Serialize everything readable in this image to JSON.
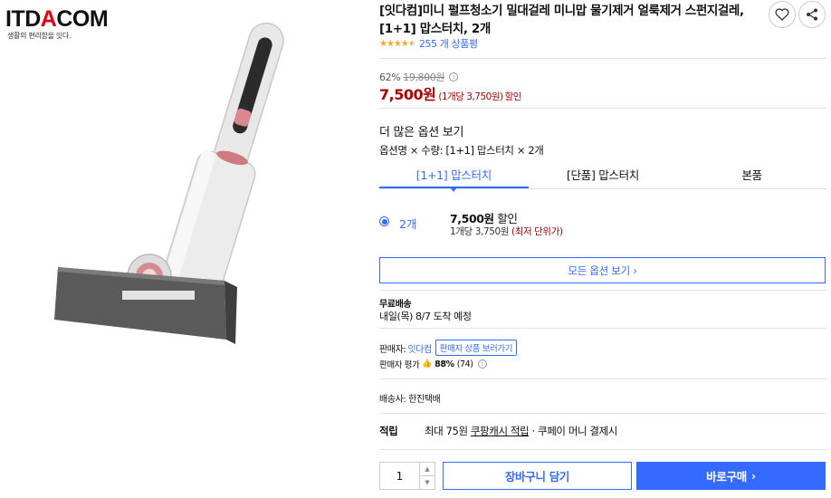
{
  "brand": {
    "logo_prefix": "ITD",
    "logo_a": "A",
    "logo_suffix": "COM",
    "tagline": "생활의 편리함을 잇다."
  },
  "product": {
    "title": "[잇다컴]미니 펄프청소기 밀대걸레 미니맙 물기제거 얼룩제거 스펀지걸레, [1+1] 맙스터치, 2개",
    "rating": 4.5,
    "review_count": "255 개 상품평"
  },
  "pricing": {
    "discount_rate": "62%",
    "original_price": "19,800원",
    "sale_price": "7,500원",
    "unit_price": "(1개당 3,750원)",
    "sale_suffix": "할인"
  },
  "options": {
    "more_title": "더 많은 옵션 보기",
    "selected_text": "옵션명 × 수량: [1+1] 맙스터치 × 2개",
    "tabs": [
      {
        "label": "[1+1] 맙스터치",
        "active": true
      },
      {
        "label": "[단품] 맙스터치",
        "active": false
      },
      {
        "label": "본품",
        "active": false
      }
    ],
    "quantity_option": {
      "label": "2개",
      "price": "7,500원",
      "price_suffix": "할인",
      "unit": "1개당 3,750원",
      "unit_note": "(최저 단위가)"
    },
    "all_options_label": "모든 옵션 보기 ›"
  },
  "shipping": {
    "title": "무료배송",
    "date": "내일(목) 8/7 도착 예정"
  },
  "seller": {
    "label": "판매자:",
    "name": "잇다컴",
    "link": "판매자 상품 보러가기",
    "rating_label": "판매자 평가",
    "rating_value": "88%",
    "rating_count": "(74)"
  },
  "courier": "배송사: 한진택배",
  "reward": {
    "label": "적립",
    "text_prefix": "최대 75원",
    "text_link": "쿠팡캐시 적립",
    "text_suffix": "· 쿠페이 머니 결제시"
  },
  "purchase": {
    "quantity": "1",
    "cart_label": "장바구니 담기",
    "buy_label": "바로구매",
    "buy_arrow": "›"
  },
  "colors": {
    "accent": "#346aff",
    "price": "#ae0000",
    "star": "#f5a623"
  },
  "icons": [
    "heart-icon",
    "share-icon",
    "info-icon",
    "thumbs-up-icon",
    "chevron-right-icon"
  ]
}
